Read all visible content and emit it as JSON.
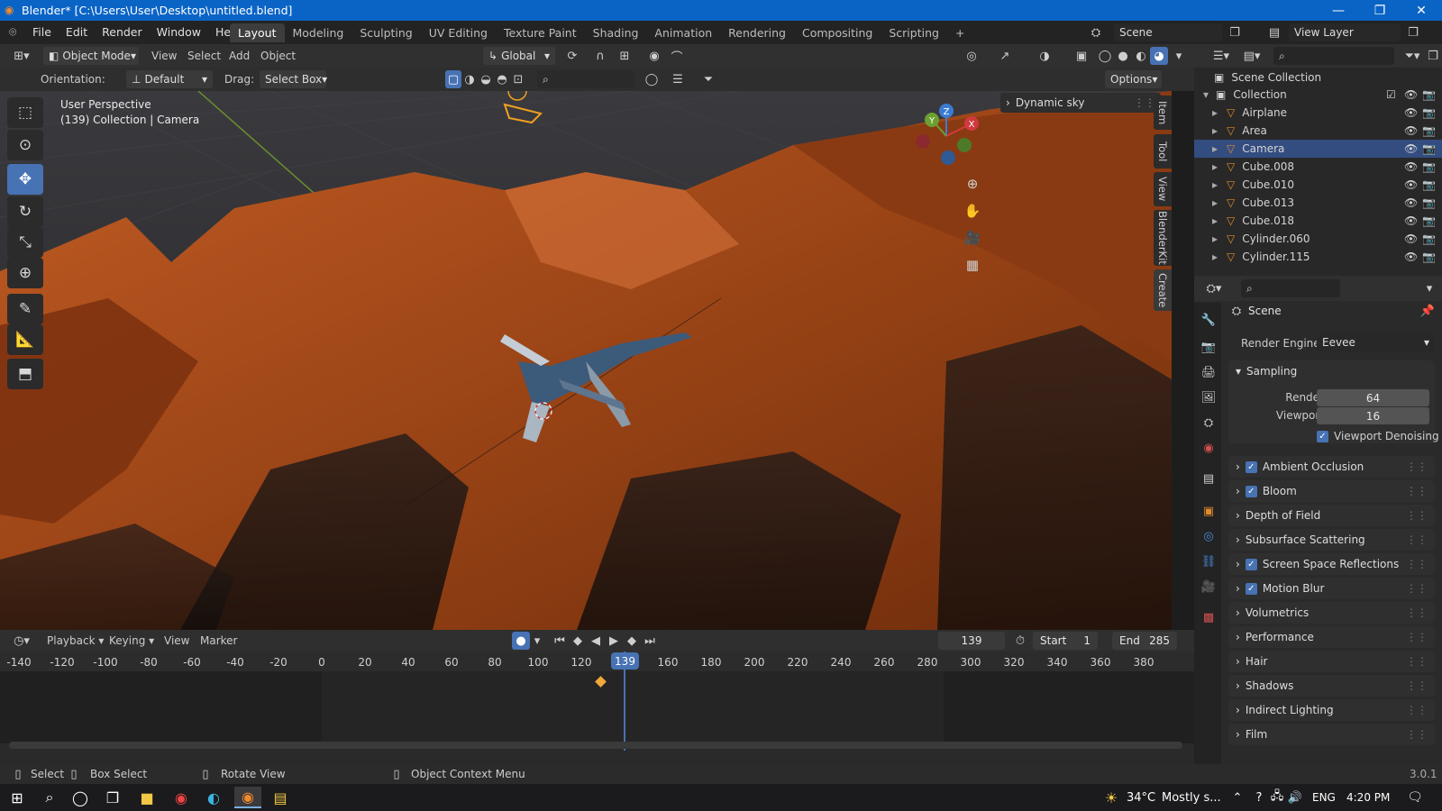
{
  "window": {
    "title": "Blender* [C:\\Users\\User\\Desktop\\untitled.blend]"
  },
  "menu": [
    "File",
    "Edit",
    "Render",
    "Window",
    "Help"
  ],
  "workspaces": [
    "Layout",
    "Modeling",
    "Sculpting",
    "UV Editing",
    "Texture Paint",
    "Shading",
    "Animation",
    "Rendering",
    "Compositing",
    "Scripting"
  ],
  "scene_name": "Scene",
  "view_layer": "View Layer",
  "viewport": {
    "mode": "Object Mode",
    "menus": [
      "View",
      "Select",
      "Add",
      "Object"
    ],
    "transform_orientation": "Global",
    "orientation_label": "Orientation:",
    "orientation_value": "Default",
    "drag_label": "Drag:",
    "drag_value": "Select Box",
    "options_label": "Options",
    "overlay_line1": "User Perspective",
    "overlay_line2": "(139) Collection | Camera",
    "panel_title": "Dynamic sky",
    "side_tabs": [
      "Item",
      "Tool",
      "View",
      "BlenderKit",
      "Create"
    ],
    "gizmo_axes": [
      "X",
      "Y",
      "Z"
    ]
  },
  "timeline": {
    "menus": [
      "Playback",
      "Keying",
      "View",
      "Marker"
    ],
    "current_frame": "139",
    "start_label": "Start",
    "start": "1",
    "end_label": "End",
    "end": "285",
    "ruler": [
      "-140",
      "-120",
      "-100",
      "-80",
      "-60",
      "-40",
      "-20",
      "0",
      "20",
      "40",
      "60",
      "80",
      "100",
      "120",
      "139",
      "160",
      "180",
      "200",
      "220",
      "240",
      "260",
      "280",
      "300",
      "320",
      "340",
      "360",
      "380"
    ]
  },
  "outliner": {
    "root": "Scene Collection",
    "collection": "Collection",
    "items": [
      {
        "name": "Airplane",
        "selected": false
      },
      {
        "name": "Area",
        "selected": false
      },
      {
        "name": "Camera",
        "selected": true
      },
      {
        "name": "Cube.008",
        "selected": false
      },
      {
        "name": "Cube.010",
        "selected": false
      },
      {
        "name": "Cube.013",
        "selected": false
      },
      {
        "name": "Cube.018",
        "selected": false
      },
      {
        "name": "Cylinder.060",
        "selected": false
      },
      {
        "name": "Cylinder.115",
        "selected": false
      }
    ]
  },
  "properties": {
    "context": "Scene",
    "render_engine_label": "Render Engine",
    "render_engine": "Eevee",
    "sampling": {
      "title": "Sampling",
      "render_label": "Render",
      "render": "64",
      "viewport_label": "Viewport",
      "viewport": "16",
      "denoise_label": "Viewport Denoising",
      "denoise": true
    },
    "panels": [
      {
        "label": "Ambient Occlusion",
        "checkbox": true
      },
      {
        "label": "Bloom",
        "checkbox": true
      },
      {
        "label": "Depth of Field",
        "checkbox": false
      },
      {
        "label": "Subsurface Scattering",
        "checkbox": false
      },
      {
        "label": "Screen Space Reflections",
        "checkbox": true
      },
      {
        "label": "Motion Blur",
        "checkbox": true
      },
      {
        "label": "Volumetrics",
        "checkbox": false
      },
      {
        "label": "Performance",
        "checkbox": false
      },
      {
        "label": "Hair",
        "checkbox": false
      },
      {
        "label": "Shadows",
        "checkbox": false
      },
      {
        "label": "Indirect Lighting",
        "checkbox": false
      },
      {
        "label": "Film",
        "checkbox": false
      }
    ]
  },
  "statusbar": {
    "select": "Select",
    "box_select": "Box Select",
    "rotate_view": "Rotate View",
    "context_menu": "Object Context Menu",
    "version": "3.0.1"
  },
  "taskbar": {
    "temperature": "34°C",
    "weather": "Mostly s...",
    "language": "ENG",
    "time": "4:20 PM"
  },
  "colors": {
    "accent": "#4772b3",
    "titlebar": "#0a64c6",
    "terrain": "#b8541f",
    "selected_row": "#334d80"
  }
}
